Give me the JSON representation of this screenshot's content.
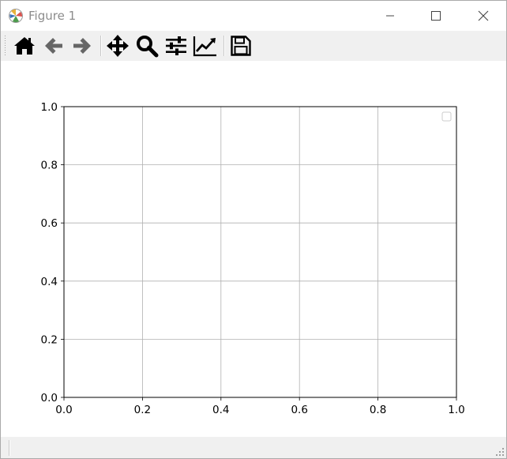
{
  "window": {
    "title": "Figure 1",
    "controls": [
      "minimize",
      "maximize",
      "close"
    ]
  },
  "toolbar": {
    "tools": [
      {
        "name": "home",
        "icon": "home-icon"
      },
      {
        "name": "back",
        "icon": "arrow-left-icon"
      },
      {
        "name": "forward",
        "icon": "arrow-right-icon"
      },
      {
        "name": "pan",
        "icon": "move-arrows-icon"
      },
      {
        "name": "zoom",
        "icon": "magnifier-icon"
      },
      {
        "name": "configure-subplots",
        "icon": "sliders-icon"
      },
      {
        "name": "edit-axis",
        "icon": "line-chart-icon"
      },
      {
        "name": "save",
        "icon": "floppy-disk-icon"
      }
    ]
  },
  "chart_data": {
    "type": "line",
    "title": "",
    "xlabel": "",
    "ylabel": "",
    "xlim": [
      0.0,
      1.0
    ],
    "ylim": [
      0.0,
      1.0
    ],
    "xticks": [
      "0.0",
      "0.2",
      "0.4",
      "0.6",
      "0.8",
      "1.0"
    ],
    "yticks": [
      "0.0",
      "0.2",
      "0.4",
      "0.6",
      "0.8",
      "1.0"
    ],
    "grid": true,
    "legend": "upper-right, empty",
    "series": []
  },
  "colors": {
    "grid": "#b0b0b0",
    "axes": "#000000",
    "toolbar_bg": "#f0f0f0",
    "title_text": "#8c8c8c"
  }
}
